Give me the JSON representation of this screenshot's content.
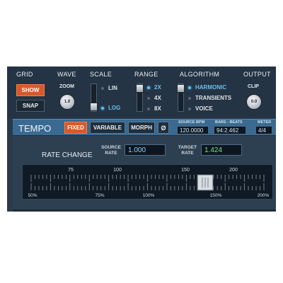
{
  "headers": {
    "grid": "GRID",
    "wave": "WAVE",
    "scale": "SCALE",
    "range": "RANGE",
    "algorithm": "ALGORITHM",
    "output": "OUTPUT"
  },
  "grid": {
    "show_label": "SHOW",
    "snap_label": "SNAP",
    "show_active": true
  },
  "wave": {
    "zoom_label": "ZOOM",
    "knob_value": "1.0"
  },
  "scale": {
    "options": [
      "LIN",
      "LOG"
    ],
    "selected": "LOG"
  },
  "range": {
    "options": [
      "2X",
      "4X",
      "8X"
    ],
    "selected": "2X"
  },
  "algorithm": {
    "options": [
      "HARMONIC",
      "TRANSIENTS",
      "VOICE"
    ],
    "selected": "HARMONIC"
  },
  "output": {
    "clip_label": "CLIP",
    "knob_value": "0.0"
  },
  "tempo": {
    "title": "TEMPO",
    "modes": [
      "FIXED",
      "VARIABLE",
      "MORPH"
    ],
    "active_mode": "FIXED",
    "reset_symbol": "Ø",
    "source_bpm_label": "SOURCE BPM",
    "source_bpm_value": "120.0000",
    "bars_beats_label": "BARS : BEATS",
    "bars_beats_value": "94:2.462",
    "meter_label": "METER",
    "meter_value": "4/4"
  },
  "rate": {
    "title": "RATE CHANGE",
    "source_label_1": "SOURCE",
    "source_label_2": "RATE",
    "source_value": "1.000",
    "target_label_1": "TARGET",
    "target_label_2": "RATE",
    "target_value": "1.424",
    "ruler_top_labels": [
      "75",
      "100",
      "150",
      "200"
    ],
    "ruler_bottom_labels": [
      "50%",
      "75%",
      "100%",
      "150%",
      "200%"
    ],
    "slider_value": 1.424
  },
  "colors": {
    "accent_orange": "#d8582a",
    "selected_blue": "#5ac4ff",
    "target_green": "#7fe07f",
    "source_blue": "#8fd0ff"
  }
}
